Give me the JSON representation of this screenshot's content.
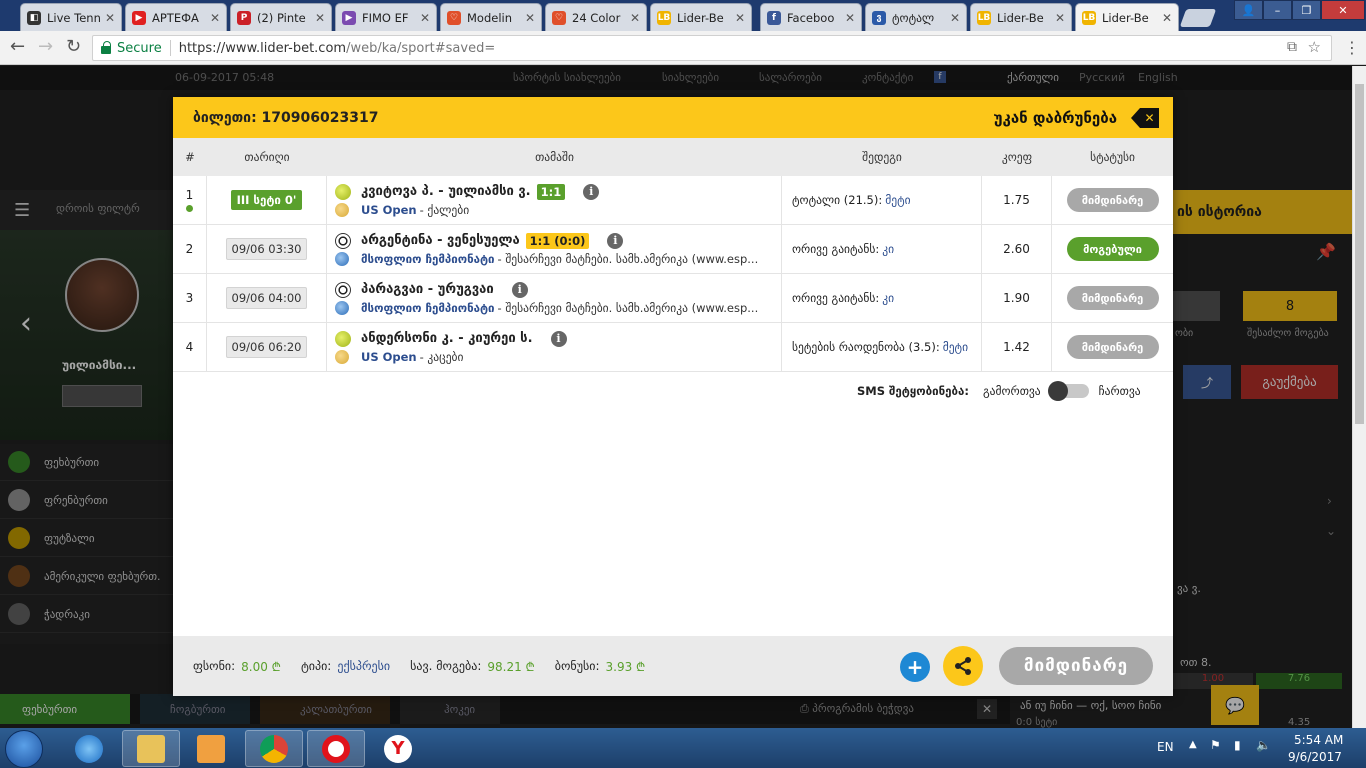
{
  "browser": {
    "tabs": [
      {
        "title": "Live Tennis",
        "fav_color": "#333",
        "fav_glyph": "◧"
      },
      {
        "title": "APTEФA",
        "fav_color": "#e02020",
        "fav_glyph": "▶"
      },
      {
        "title": "(2) Pinte",
        "fav_color": "#cb2027",
        "fav_glyph": "P"
      },
      {
        "title": "FIMO EF",
        "fav_color": "#7b4bb0",
        "fav_glyph": "▶"
      },
      {
        "title": "Modelin",
        "fav_color": "#e04f2a",
        "fav_glyph": "♡"
      },
      {
        "title": "24 Color",
        "fav_color": "#e04f2a",
        "fav_glyph": "♡"
      },
      {
        "title": "Lider-Be",
        "fav_color": "#f0b400",
        "fav_glyph": "LB"
      },
      {
        "title": "Faceboo",
        "fav_color": "#3b5998",
        "fav_glyph": "f"
      },
      {
        "title": "ტოტალ",
        "fav_color": "#2b5aa8",
        "fav_glyph": "ვ"
      },
      {
        "title": "Lider-Be",
        "fav_color": "#f0b400",
        "fav_glyph": "LB"
      },
      {
        "title": "Lider-Be",
        "fav_color": "#f0b400",
        "fav_glyph": "LB"
      }
    ],
    "secure_label": "Secure",
    "url_base": "https://www.lider-bet.com",
    "url_path": "/web/ka/sport#saved="
  },
  "site": {
    "datetime": "06-09-2017 05:48",
    "top_links": [
      "სპორტის სიახლეები",
      "სიახლეები",
      "სალაროები",
      "კონტაქტი"
    ],
    "languages": [
      "ქართული",
      "Русский",
      "English"
    ],
    "sidebar": [
      "ფეხბურთი",
      "ფრენბურთი",
      "ფუტზალი",
      "ამერიკული ფეხბურთ.",
      "ჭადრაკი"
    ],
    "bottom_tabs": [
      "ფეხბურთი",
      "ჩოგბურთი",
      "კალათბურთი",
      "ჰოკეი"
    ],
    "print_label": "პროგრამის ბეჭდვა",
    "player_name": "უილიამსი...",
    "right_title": "ის ისტორია",
    "right_count": "8",
    "right_label_a": "ობი",
    "right_label_b": "შესაძლო მოგება",
    "right_cancel": "გაუქმება",
    "right_odd_a": "1.00",
    "right_odd_b": "7.76",
    "right_odd_c": "4.35",
    "right_text_1": "ვა ვ.",
    "right_text_2": "ოთ 8.",
    "right_text_3": "ან იუ ჩინი — ოქ, სოო ჩინი",
    "right_text_4": "0:0 სეტი",
    "live_filter": "დროის ფილტრ"
  },
  "modal": {
    "ticket_label": "ბილეთი: 170906023317",
    "back_label": "უკან დაბრუნება",
    "headers": [
      "#",
      "თარიღი",
      "თამაში",
      "შედეგი",
      "კოეფ",
      "სტატუსი"
    ],
    "rows": [
      {
        "num": "1",
        "date": "III სეტი 0'",
        "live": true,
        "sport": "tennis",
        "match": "კვიტოვა პ. - უილიამსი ვ.",
        "score": "1:1",
        "score_style": "green",
        "league": "US Open",
        "league_sub": "- ქალები",
        "league_icon": "tennis",
        "result_label": "ტოტალი (21.5):",
        "result_value": "მეტი",
        "odd": "1.75",
        "status": "მიმდინარე",
        "status_style": "grey"
      },
      {
        "num": "2",
        "date": "09/06 03:30",
        "live": false,
        "sport": "football",
        "match": "არგენტინა - ვენესუელა",
        "score": "1:1 (0:0)",
        "score_style": "yellow",
        "league": "მსოფლიო ჩემპიონატი",
        "league_sub": "- შესარჩევი მატჩები. სამხ.ამერიკა (www.esp...",
        "league_icon": "globe",
        "result_label": "ორივე გაიტანს:",
        "result_value": "კი",
        "odd": "2.60",
        "status": "მოგებული",
        "status_style": "green"
      },
      {
        "num": "3",
        "date": "09/06 04:00",
        "live": false,
        "sport": "football",
        "match": "პარაგვაი - ურუგვაი",
        "score": "",
        "score_style": "",
        "league": "მსოფლიო ჩემპიონატი",
        "league_sub": "- შესარჩევი მატჩები. სამხ.ამერიკა (www.esp...",
        "league_icon": "globe",
        "result_label": "ორივე გაიტანს:",
        "result_value": "კი",
        "odd": "1.90",
        "status": "მიმდინარე",
        "status_style": "grey"
      },
      {
        "num": "4",
        "date": "09/06 06:20",
        "live": false,
        "sport": "tennis",
        "match": "ანდერსონი კ. - კიურეი ს.",
        "score": "",
        "score_style": "",
        "league": "US Open",
        "league_sub": "- კაცები",
        "league_icon": "tennis",
        "result_label": "სეტების რაოდენობა (3.5):",
        "result_value": "მეტი",
        "odd": "1.42",
        "status": "მიმდინარე",
        "status_style": "grey"
      }
    ],
    "sms_label": "SMS შეტყობინება:",
    "sms_off": "გამორთვა",
    "sms_on": "ჩართვა",
    "footer": {
      "stake_label": "ფსონი:",
      "stake_value": "8.00 ₾",
      "type_label": "ტიპი:",
      "type_value": "ექსპრესი",
      "win_label": "სავ. მოგება:",
      "win_value": "98.21 ₾",
      "bonus_label": "ბონუსი:",
      "bonus_value": "3.93 ₾",
      "status_button": "მიმდინარე"
    }
  },
  "taskbar": {
    "lang": "EN",
    "time": "5:54 AM",
    "date": "9/6/2017"
  },
  "colors": {
    "accent": "#fcc71a",
    "win": "#5aa02c",
    "link": "#2c4d8e",
    "pending": "#a8a8a8"
  }
}
